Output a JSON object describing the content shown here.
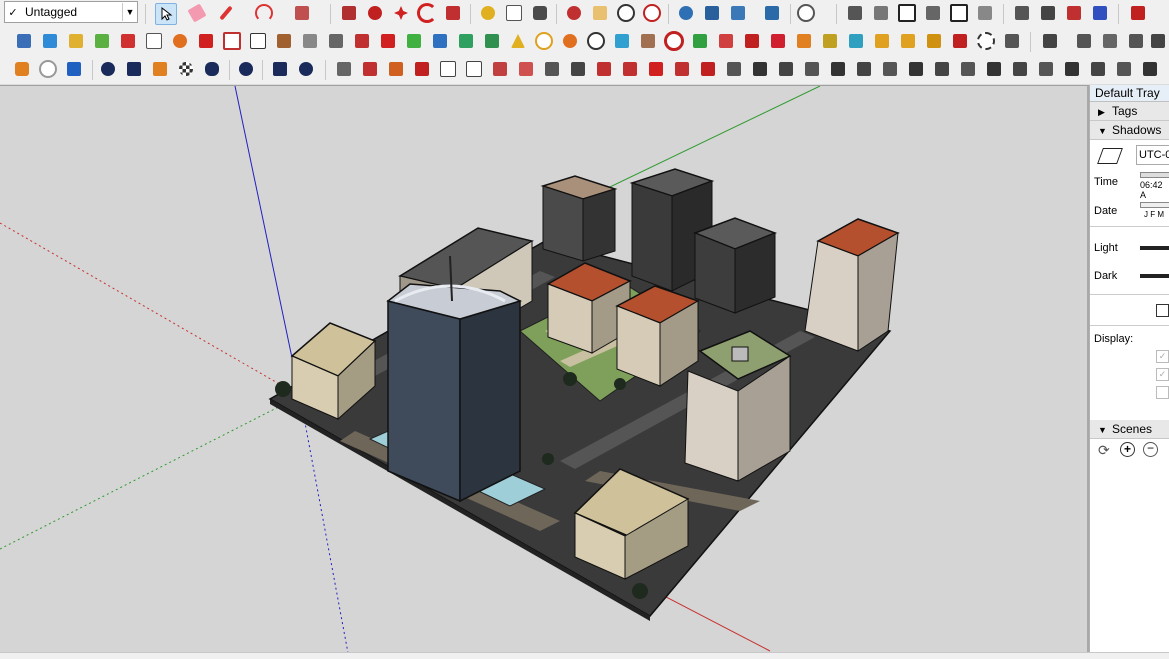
{
  "tag_selector": {
    "checked": "✓",
    "value": "Untagged"
  },
  "tray": {
    "title": "Default Tray",
    "sections": {
      "tags": "Tags",
      "shadows": "Shadows",
      "scenes": "Scenes"
    },
    "shadows": {
      "timezone": "UTC-0",
      "time_label": "Time",
      "time_value": "06:42 A",
      "date_label": "Date",
      "months": "J  F  M",
      "light_label": "Light",
      "dark_label": "Dark",
      "display_label": "Display:"
    }
  },
  "colors": {
    "viewport_bg": "#d5d5d5",
    "axis_red": "#c83030",
    "axis_green": "#2f9a2f",
    "axis_blue": "#2020c0",
    "roof_red": "#b5502e",
    "ground": "#3a3a3a",
    "grass": "#7fa05a"
  }
}
